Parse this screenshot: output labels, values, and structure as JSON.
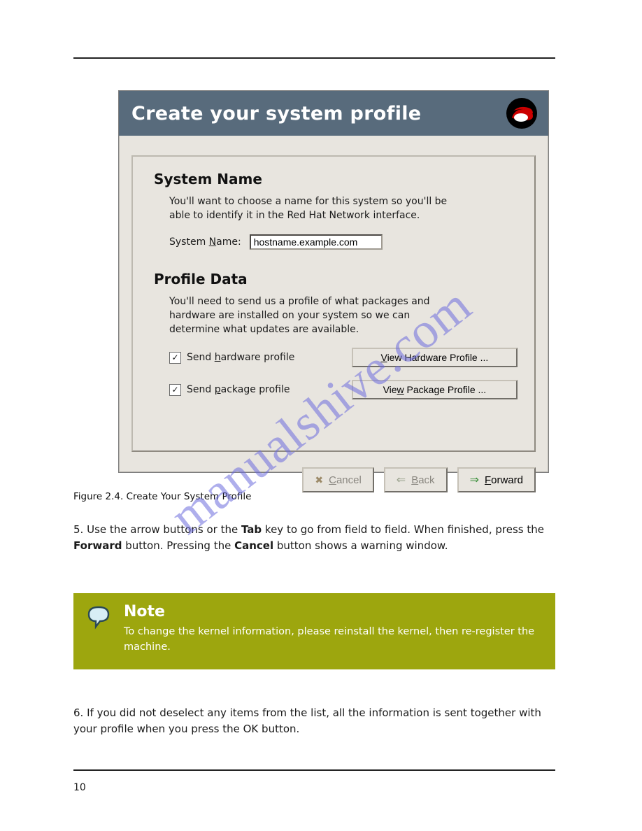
{
  "rules": {
    "top": true,
    "bottom": true
  },
  "dialog": {
    "title": "Create your system profile",
    "logo_name": "redhat-shadowman-icon",
    "system_name": {
      "heading": "System Name",
      "helper": "You'll want to choose a name for this system so you'll be able to identify it in the Red Hat Network interface.",
      "label_pre": "System ",
      "label_m": "N",
      "label_post": "ame:",
      "value": "hostname.example.com"
    },
    "profile_data": {
      "heading": "Profile Data",
      "helper": "You'll need to send us a profile of what packages and hardware are installed on your system so we can determine what updates are available.",
      "hw_check": {
        "checked": true,
        "pre": "Send ",
        "m": "h",
        "post": "ardware profile"
      },
      "pkg_check": {
        "checked": true,
        "pre": "Send ",
        "m": "p",
        "post": "ackage profile"
      },
      "hw_btn_m": "V",
      "hw_btn_rest": "iew Hardware Profile ...",
      "pkg_btn_pre": "Vie",
      "pkg_btn_m": "w",
      "pkg_btn_rest": " Package Profile ..."
    },
    "nav": {
      "cancel_m": "C",
      "cancel_rest": "ancel",
      "back_m": "B",
      "back_rest": "ack",
      "forward_m": "F",
      "forward_rest": "orward"
    }
  },
  "figure_caption": "Figure 2.4. Create Your System Profile",
  "para5": {
    "num": "5. ",
    "pre": "Use the arrow buttons or the ",
    "tab": "Tab",
    "mid1": " key to go from field to field. When finished, press the ",
    "fwd": "Forward",
    "mid2": " button. Pressing the ",
    "cancel": "Cancel",
    "end": " button shows a warning window."
  },
  "note": {
    "title": "Note",
    "body": "To change the kernel information, please reinstall the kernel, then re-register the machine."
  },
  "para6": {
    "num": "6. ",
    "pre": "If you did not deselect any items from the list, all the information is sent together with your profile when you press the ",
    "ok": "OK",
    "end": " button."
  },
  "page_number": "10",
  "watermark": "manualshive.com"
}
